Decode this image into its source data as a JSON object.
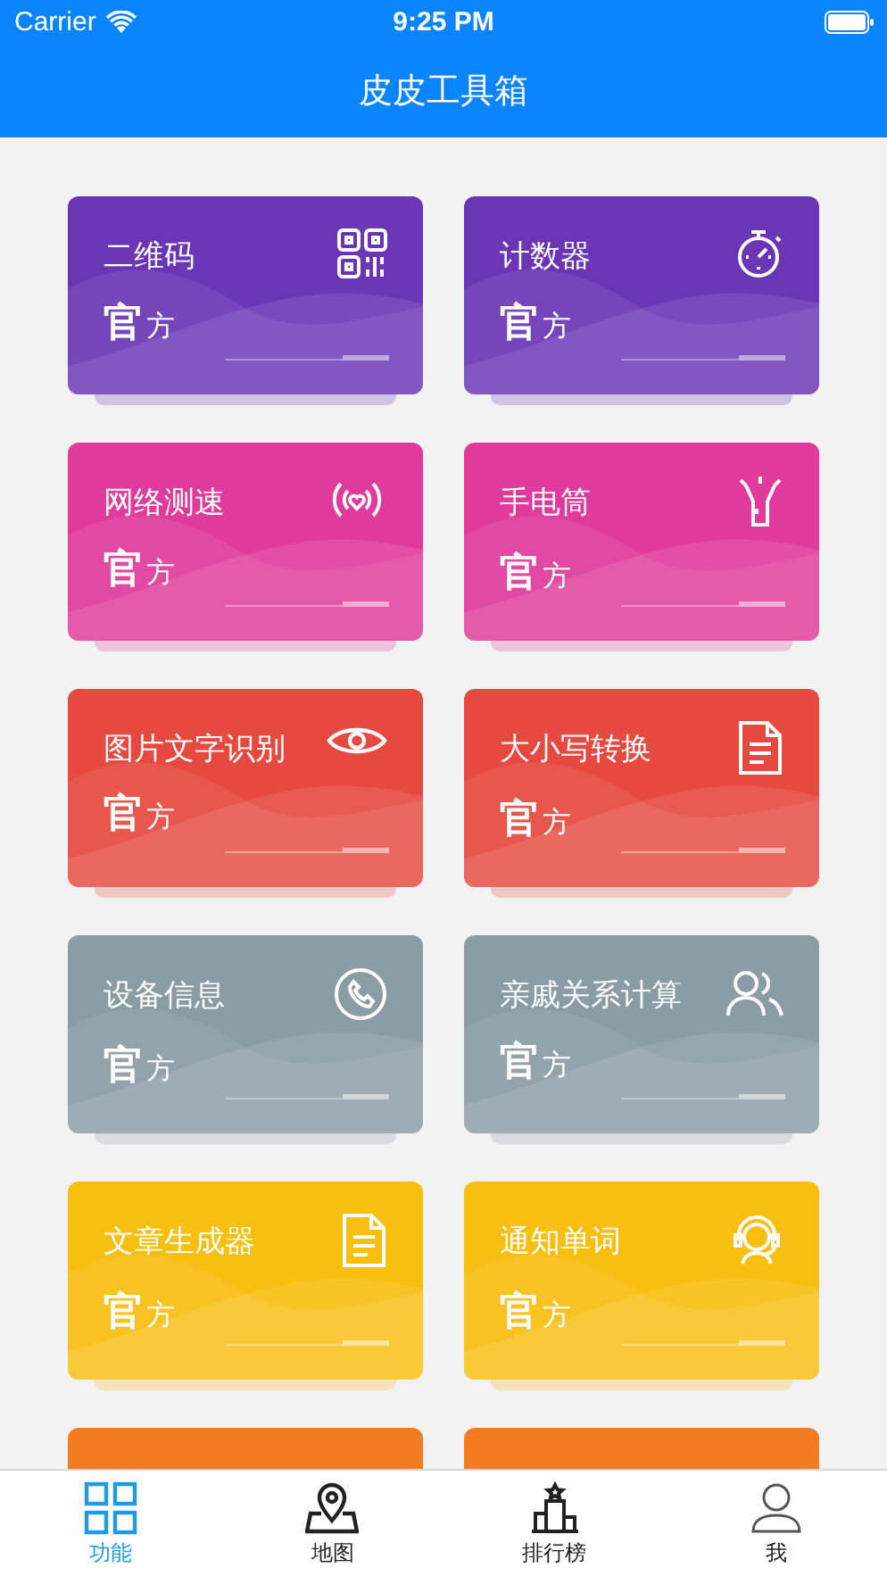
{
  "status_bar": {
    "carrier": "Carrier",
    "time": "9:25 PM"
  },
  "nav_bar": {
    "title": "皮皮工具箱"
  },
  "tools": [
    {
      "title": "二维码",
      "badge_big": "官",
      "badge_small": "方",
      "color": "#6a36b6"
    },
    {
      "title": "计数器",
      "badge_big": "官",
      "badge_small": "方",
      "color": "#6a36b6"
    },
    {
      "title": "网络测速",
      "badge_big": "官",
      "badge_small": "方",
      "color": "#e03a9c"
    },
    {
      "title": "手电筒",
      "badge_big": "官",
      "badge_small": "方",
      "color": "#e03a9c"
    },
    {
      "title": "图片文字识别",
      "badge_big": "官",
      "badge_small": "方",
      "color": "#e5493f"
    },
    {
      "title": "大小写转换",
      "badge_big": "官",
      "badge_small": "方",
      "color": "#e5493f"
    },
    {
      "title": "设备信息",
      "badge_big": "官",
      "badge_small": "方",
      "color": "#8a9ca4"
    },
    {
      "title": "亲戚关系计算",
      "badge_big": "官",
      "badge_small": "方",
      "color": "#8a9ca4"
    },
    {
      "title": "文章生成器",
      "badge_big": "官",
      "badge_small": "方",
      "color": "#f8be10"
    },
    {
      "title": "通知单词",
      "badge_big": "官",
      "badge_small": "方",
      "color": "#f8be10"
    },
    {
      "color": "#f37c22"
    },
    {
      "color": "#f37c22"
    }
  ],
  "tab_bar": [
    {
      "label": "功能",
      "selected": true
    },
    {
      "label": "地图",
      "selected": false
    },
    {
      "label": "排行榜",
      "selected": false
    },
    {
      "label": "我",
      "selected": false
    }
  ]
}
